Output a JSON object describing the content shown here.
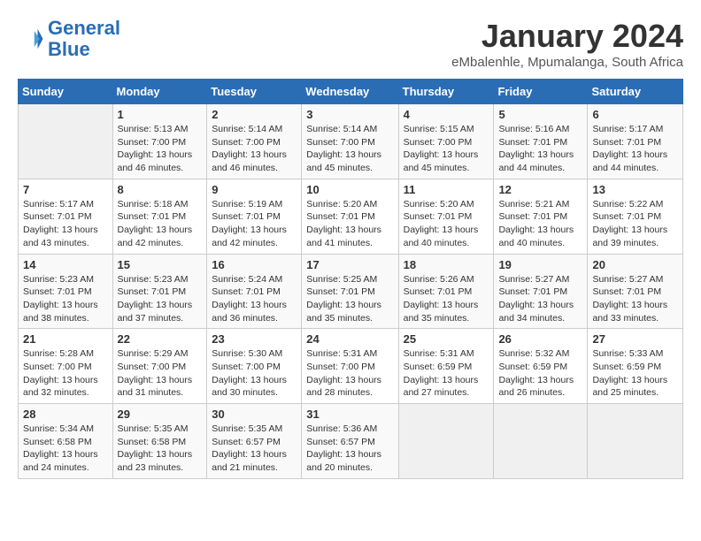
{
  "header": {
    "logo_line1": "General",
    "logo_line2": "Blue",
    "month": "January 2024",
    "location": "eMbalenhle, Mpumalanga, South Africa"
  },
  "weekdays": [
    "Sunday",
    "Monday",
    "Tuesday",
    "Wednesday",
    "Thursday",
    "Friday",
    "Saturday"
  ],
  "weeks": [
    [
      {
        "day": "",
        "sunrise": "",
        "sunset": "",
        "daylight": ""
      },
      {
        "day": "1",
        "sunrise": "Sunrise: 5:13 AM",
        "sunset": "Sunset: 7:00 PM",
        "daylight": "Daylight: 13 hours and 46 minutes."
      },
      {
        "day": "2",
        "sunrise": "Sunrise: 5:14 AM",
        "sunset": "Sunset: 7:00 PM",
        "daylight": "Daylight: 13 hours and 46 minutes."
      },
      {
        "day": "3",
        "sunrise": "Sunrise: 5:14 AM",
        "sunset": "Sunset: 7:00 PM",
        "daylight": "Daylight: 13 hours and 45 minutes."
      },
      {
        "day": "4",
        "sunrise": "Sunrise: 5:15 AM",
        "sunset": "Sunset: 7:00 PM",
        "daylight": "Daylight: 13 hours and 45 minutes."
      },
      {
        "day": "5",
        "sunrise": "Sunrise: 5:16 AM",
        "sunset": "Sunset: 7:01 PM",
        "daylight": "Daylight: 13 hours and 44 minutes."
      },
      {
        "day": "6",
        "sunrise": "Sunrise: 5:17 AM",
        "sunset": "Sunset: 7:01 PM",
        "daylight": "Daylight: 13 hours and 44 minutes."
      }
    ],
    [
      {
        "day": "7",
        "sunrise": "Sunrise: 5:17 AM",
        "sunset": "Sunset: 7:01 PM",
        "daylight": "Daylight: 13 hours and 43 minutes."
      },
      {
        "day": "8",
        "sunrise": "Sunrise: 5:18 AM",
        "sunset": "Sunset: 7:01 PM",
        "daylight": "Daylight: 13 hours and 42 minutes."
      },
      {
        "day": "9",
        "sunrise": "Sunrise: 5:19 AM",
        "sunset": "Sunset: 7:01 PM",
        "daylight": "Daylight: 13 hours and 42 minutes."
      },
      {
        "day": "10",
        "sunrise": "Sunrise: 5:20 AM",
        "sunset": "Sunset: 7:01 PM",
        "daylight": "Daylight: 13 hours and 41 minutes."
      },
      {
        "day": "11",
        "sunrise": "Sunrise: 5:20 AM",
        "sunset": "Sunset: 7:01 PM",
        "daylight": "Daylight: 13 hours and 40 minutes."
      },
      {
        "day": "12",
        "sunrise": "Sunrise: 5:21 AM",
        "sunset": "Sunset: 7:01 PM",
        "daylight": "Daylight: 13 hours and 40 minutes."
      },
      {
        "day": "13",
        "sunrise": "Sunrise: 5:22 AM",
        "sunset": "Sunset: 7:01 PM",
        "daylight": "Daylight: 13 hours and 39 minutes."
      }
    ],
    [
      {
        "day": "14",
        "sunrise": "Sunrise: 5:23 AM",
        "sunset": "Sunset: 7:01 PM",
        "daylight": "Daylight: 13 hours and 38 minutes."
      },
      {
        "day": "15",
        "sunrise": "Sunrise: 5:23 AM",
        "sunset": "Sunset: 7:01 PM",
        "daylight": "Daylight: 13 hours and 37 minutes."
      },
      {
        "day": "16",
        "sunrise": "Sunrise: 5:24 AM",
        "sunset": "Sunset: 7:01 PM",
        "daylight": "Daylight: 13 hours and 36 minutes."
      },
      {
        "day": "17",
        "sunrise": "Sunrise: 5:25 AM",
        "sunset": "Sunset: 7:01 PM",
        "daylight": "Daylight: 13 hours and 35 minutes."
      },
      {
        "day": "18",
        "sunrise": "Sunrise: 5:26 AM",
        "sunset": "Sunset: 7:01 PM",
        "daylight": "Daylight: 13 hours and 35 minutes."
      },
      {
        "day": "19",
        "sunrise": "Sunrise: 5:27 AM",
        "sunset": "Sunset: 7:01 PM",
        "daylight": "Daylight: 13 hours and 34 minutes."
      },
      {
        "day": "20",
        "sunrise": "Sunrise: 5:27 AM",
        "sunset": "Sunset: 7:01 PM",
        "daylight": "Daylight: 13 hours and 33 minutes."
      }
    ],
    [
      {
        "day": "21",
        "sunrise": "Sunrise: 5:28 AM",
        "sunset": "Sunset: 7:00 PM",
        "daylight": "Daylight: 13 hours and 32 minutes."
      },
      {
        "day": "22",
        "sunrise": "Sunrise: 5:29 AM",
        "sunset": "Sunset: 7:00 PM",
        "daylight": "Daylight: 13 hours and 31 minutes."
      },
      {
        "day": "23",
        "sunrise": "Sunrise: 5:30 AM",
        "sunset": "Sunset: 7:00 PM",
        "daylight": "Daylight: 13 hours and 30 minutes."
      },
      {
        "day": "24",
        "sunrise": "Sunrise: 5:31 AM",
        "sunset": "Sunset: 7:00 PM",
        "daylight": "Daylight: 13 hours and 28 minutes."
      },
      {
        "day": "25",
        "sunrise": "Sunrise: 5:31 AM",
        "sunset": "Sunset: 6:59 PM",
        "daylight": "Daylight: 13 hours and 27 minutes."
      },
      {
        "day": "26",
        "sunrise": "Sunrise: 5:32 AM",
        "sunset": "Sunset: 6:59 PM",
        "daylight": "Daylight: 13 hours and 26 minutes."
      },
      {
        "day": "27",
        "sunrise": "Sunrise: 5:33 AM",
        "sunset": "Sunset: 6:59 PM",
        "daylight": "Daylight: 13 hours and 25 minutes."
      }
    ],
    [
      {
        "day": "28",
        "sunrise": "Sunrise: 5:34 AM",
        "sunset": "Sunset: 6:58 PM",
        "daylight": "Daylight: 13 hours and 24 minutes."
      },
      {
        "day": "29",
        "sunrise": "Sunrise: 5:35 AM",
        "sunset": "Sunset: 6:58 PM",
        "daylight": "Daylight: 13 hours and 23 minutes."
      },
      {
        "day": "30",
        "sunrise": "Sunrise: 5:35 AM",
        "sunset": "Sunset: 6:57 PM",
        "daylight": "Daylight: 13 hours and 21 minutes."
      },
      {
        "day": "31",
        "sunrise": "Sunrise: 5:36 AM",
        "sunset": "Sunset: 6:57 PM",
        "daylight": "Daylight: 13 hours and 20 minutes."
      },
      {
        "day": "",
        "sunrise": "",
        "sunset": "",
        "daylight": ""
      },
      {
        "day": "",
        "sunrise": "",
        "sunset": "",
        "daylight": ""
      },
      {
        "day": "",
        "sunrise": "",
        "sunset": "",
        "daylight": ""
      }
    ]
  ]
}
